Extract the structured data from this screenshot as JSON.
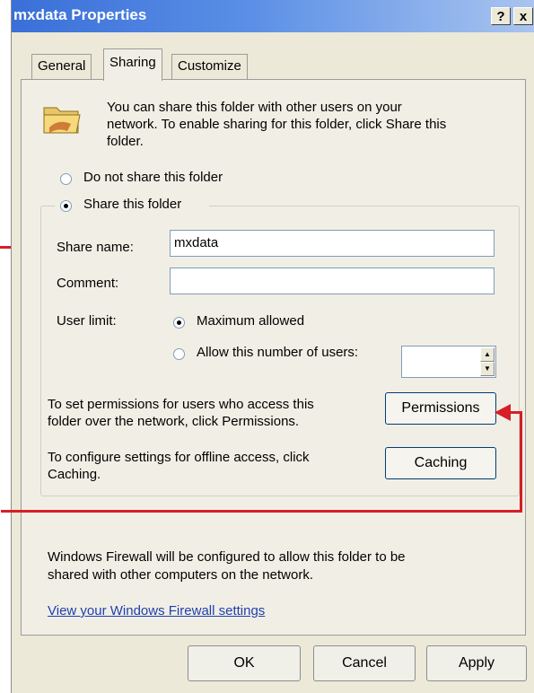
{
  "window": {
    "title": "mxdata Properties",
    "help_label": "?",
    "close_label": "x"
  },
  "tabs": [
    {
      "label": "General"
    },
    {
      "label": "Sharing"
    },
    {
      "label": "Customize"
    }
  ],
  "sharing": {
    "intro_line1": "You can share this folder with other users on your",
    "intro_line2": "network.  To enable sharing for this folder, click Share this",
    "intro_line3": "folder.",
    "do_not_share_label": "Do not share this folder",
    "share_label": "Share this folder",
    "share_selected": true,
    "share_name_label": "Share name:",
    "share_name_value": "mxdata",
    "comment_label": "Comment:",
    "comment_value": "",
    "user_limit_label": "User limit:",
    "max_allowed_label": "Maximum allowed",
    "allow_number_label": "Allow this number of users:",
    "users_value": "",
    "permissions_text_line1": "To set permissions for users who access this",
    "permissions_text_line2": "folder over the network, click Permissions.",
    "permissions_button": "Permissions",
    "caching_text_line1": "To configure settings for offline access, click",
    "caching_text_line2": "Caching.",
    "caching_button": "Caching",
    "firewall_line1": "Windows Firewall will be configured to allow this folder to be",
    "firewall_line2": "shared with other computers on the network.",
    "firewall_link": "View your Windows Firewall settings"
  },
  "buttons": {
    "ok": "OK",
    "cancel": "Cancel",
    "apply": "Apply"
  },
  "icons": {
    "folder": "shared-folder-icon",
    "spin_up": "spin-up-icon",
    "spin_down": "spin-down-icon"
  },
  "colors": {
    "titlebar": "#3a6fd8",
    "dialog_bg": "#ece9d8",
    "annotation_arrow": "#d61f26",
    "link": "#1f3fb0"
  }
}
